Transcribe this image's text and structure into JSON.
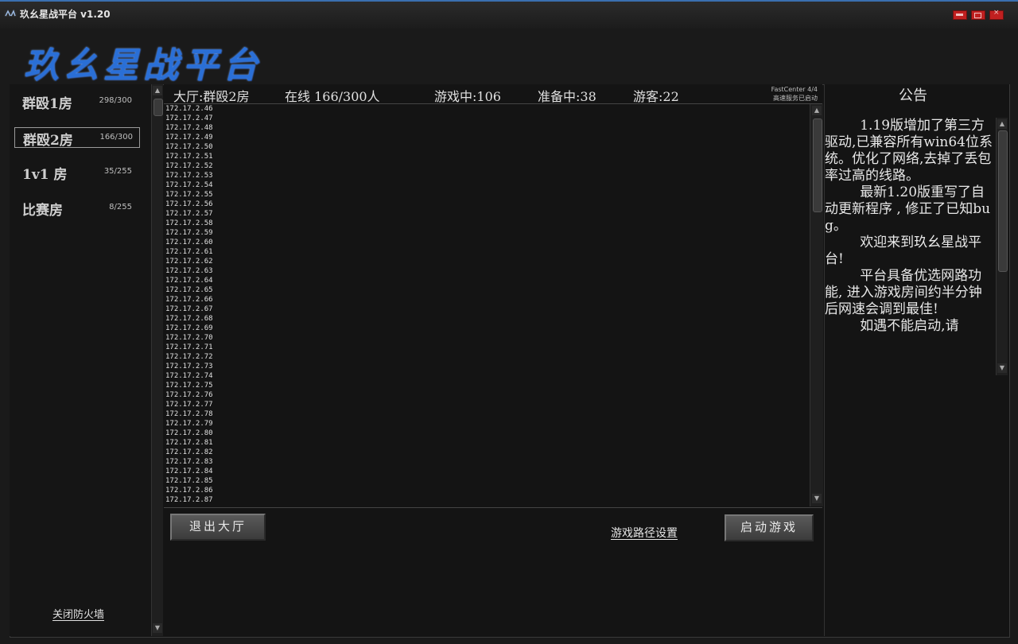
{
  "window": {
    "title": "玖幺星战平台 v1.20",
    "logo_text": "玖幺星战平台"
  },
  "rooms": [
    {
      "name": "群殴1房",
      "count": "298/300",
      "selected": false
    },
    {
      "name": "群殴2房",
      "count": "166/300",
      "selected": true
    },
    {
      "name": "1v1 房",
      "count": "35/255",
      "selected": false
    },
    {
      "name": "比赛房",
      "count": "8/255",
      "selected": false
    }
  ],
  "firewall_link": "关闭防火墙",
  "header": {
    "hall": "大厅:群殴2房",
    "online": "在线 166/300人",
    "in_game": "游戏中:106",
    "preparing": "准备中:38",
    "guests": "游客:22",
    "fastcenter": "FastCenter 4/4",
    "service_status": "高速服务已启动"
  },
  "players": [
    "172.17.2.46",
    "172.17.2.47",
    "172.17.2.48",
    "172.17.2.49",
    "172.17.2.50",
    "172.17.2.51",
    "172.17.2.52",
    "172.17.2.53",
    "172.17.2.54",
    "172.17.2.55",
    "172.17.2.56",
    "172.17.2.57",
    "172.17.2.58",
    "172.17.2.59",
    "172.17.2.60",
    "172.17.2.61",
    "172.17.2.62",
    "172.17.2.63",
    "172.17.2.64",
    "172.17.2.65",
    "172.17.2.66",
    "172.17.2.67",
    "172.17.2.68",
    "172.17.2.69",
    "172.17.2.70",
    "172.17.2.71",
    "172.17.2.72",
    "172.17.2.73",
    "172.17.2.74",
    "172.17.2.75",
    "172.17.2.76",
    "172.17.2.77",
    "172.17.2.78",
    "172.17.2.79",
    "172.17.2.80",
    "172.17.2.81",
    "172.17.2.82",
    "172.17.2.83",
    "172.17.2.84",
    "172.17.2.85",
    "172.17.2.86",
    "172.17.2.87"
  ],
  "buttons": {
    "exit_hall": "退出大厅",
    "game_path": "游戏路径设置",
    "start_game": "启动游戏"
  },
  "announcement": {
    "title": "公告",
    "paragraphs": [
      "1.19版增加了第三方驱动,已兼容所有win64位系统。优化了网络,去掉了丢包率过高的线路。",
      "最新1.20版重写了自动更新程序 , 修正了已知bug。",
      "欢迎来到玖幺星战平台!",
      "平台具备优选网路功能, 进入游戏房间约半分钟后网速会调到最佳!",
      "如遇不能启动,请"
    ]
  },
  "colors": {
    "background": "#1a1a1a",
    "logo": "#2a6fd6",
    "close_buttons": "#c02020"
  }
}
